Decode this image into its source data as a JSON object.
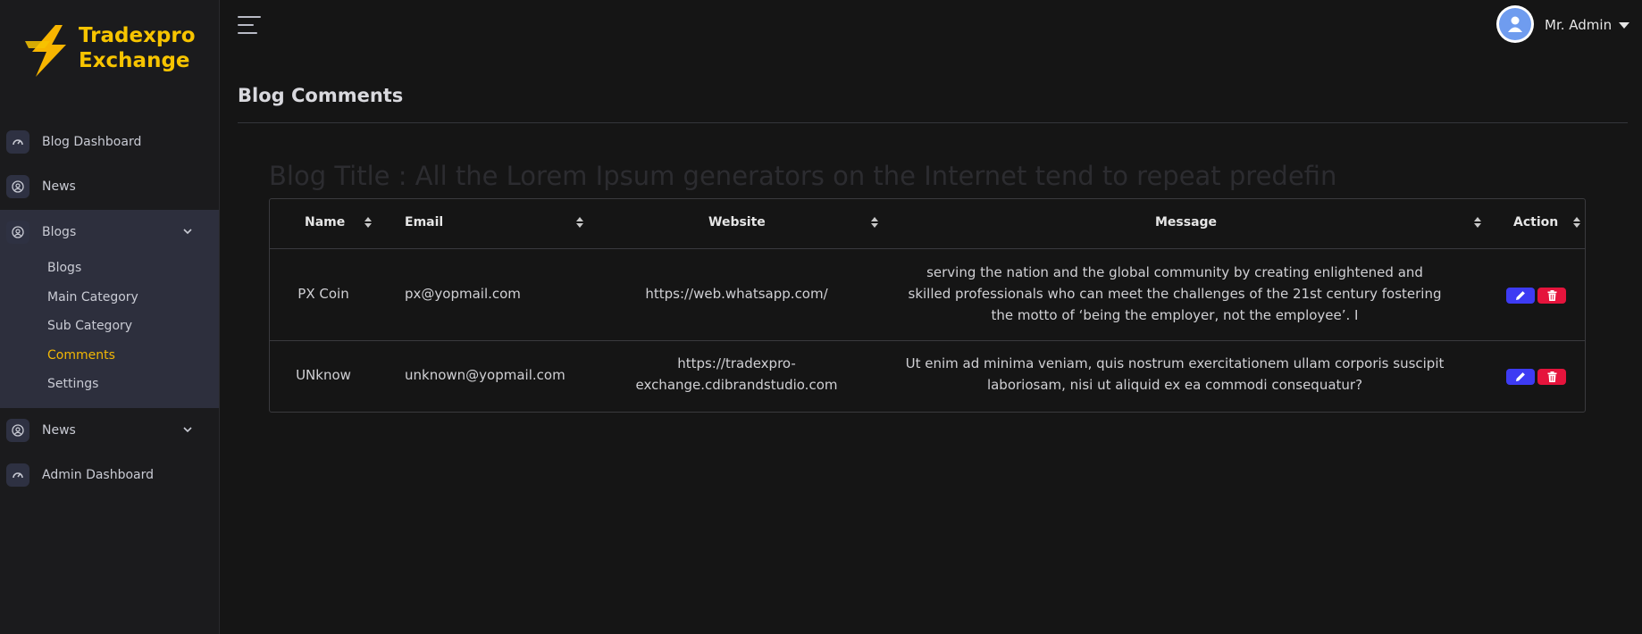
{
  "brand": {
    "line1": "Tradexpro",
    "line2": "Exchange"
  },
  "sidebar": {
    "items": [
      {
        "label": "Blog Dashboard"
      },
      {
        "label": "News"
      },
      {
        "label": "Blogs"
      },
      {
        "label": "News"
      },
      {
        "label": "Admin Dashboard"
      }
    ],
    "blogs_sub": [
      {
        "label": "Blogs"
      },
      {
        "label": "Main Category"
      },
      {
        "label": "Sub Category"
      },
      {
        "label": "Comments"
      },
      {
        "label": "Settings"
      }
    ]
  },
  "header": {
    "user_name": "Mr. Admin"
  },
  "page": {
    "title": "Blog Comments",
    "blog_title": "Blog Title : All the Lorem Ipsum generators on the Internet tend to repeat predefin"
  },
  "table": {
    "headers": [
      "Name",
      "Email",
      "Website",
      "Message",
      "Action"
    ],
    "rows": [
      {
        "name": "PX Coin",
        "email": "px@yopmail.com",
        "website": "https://web.whatsapp.com/",
        "message": "serving the nation and the global community by creating enlightened and skilled professionals who can meet the challenges of the 21st century fostering the motto of ‘being the employer, not the employee’. I"
      },
      {
        "name": "UNknow",
        "email": "unknown@yopmail.com",
        "website": "https://tradexpro-exchange.cdibrandstudio.com",
        "message": "Ut enim ad minima veniam, quis nostrum exercitationem ullam corporis suscipit laboriosam, nisi ut aliquid ex ea commodi consequatur?"
      }
    ]
  },
  "colors": {
    "accent": "#f2b705",
    "edit": "#3d3bf3",
    "delete": "#e5143c"
  }
}
